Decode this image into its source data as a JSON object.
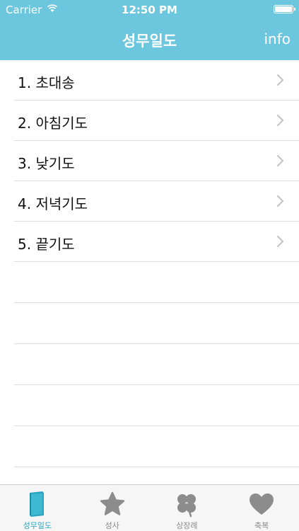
{
  "status_bar": {
    "carrier": "Carrier",
    "time": "12:50 PM"
  },
  "nav": {
    "title": "성무일도",
    "info_label": "info"
  },
  "list": {
    "items": [
      {
        "label": "1. 초대송"
      },
      {
        "label": "2. 아침기도"
      },
      {
        "label": "3. 낮기도"
      },
      {
        "label": "4. 저녁기도"
      },
      {
        "label": "5. 끝기도"
      }
    ]
  },
  "tabs": [
    {
      "label": "성무일도",
      "icon": "book-icon",
      "active": true
    },
    {
      "label": "성사",
      "icon": "star-icon",
      "active": false
    },
    {
      "label": "상장례",
      "icon": "clover-icon",
      "active": false
    },
    {
      "label": "축복",
      "icon": "heart-icon",
      "active": false
    }
  ],
  "colors": {
    "header": "#6cc6dd",
    "active_tab": "#2aa4bf",
    "inactive_tab": "#8a8a8a"
  }
}
